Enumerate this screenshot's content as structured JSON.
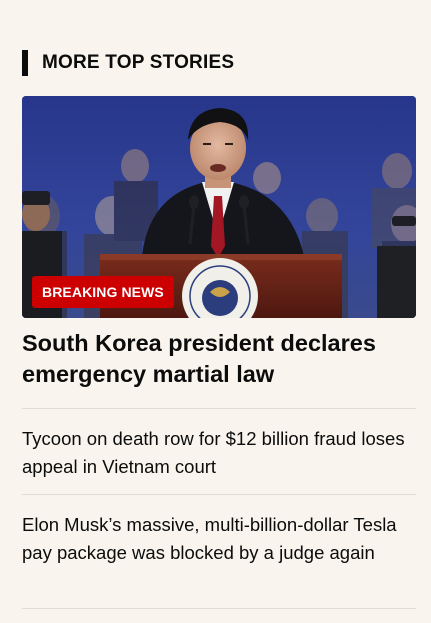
{
  "section": {
    "title": "MORE TOP STORIES"
  },
  "hero": {
    "badge": "BREAKING NEWS",
    "headline": "South Korea president declares emergency martial law",
    "colors": {
      "badge_bg": "#cc0000",
      "backdrop": "#2a3c8a",
      "podium": "#6b2418"
    }
  },
  "stories": [
    {
      "headline": "Tycoon on death row for $12 billion fraud loses appeal in Vietnam court"
    },
    {
      "headline": "Elon Musk’s massive, multi-billion-dollar Tesla pay package was blocked by a judge again"
    }
  ]
}
